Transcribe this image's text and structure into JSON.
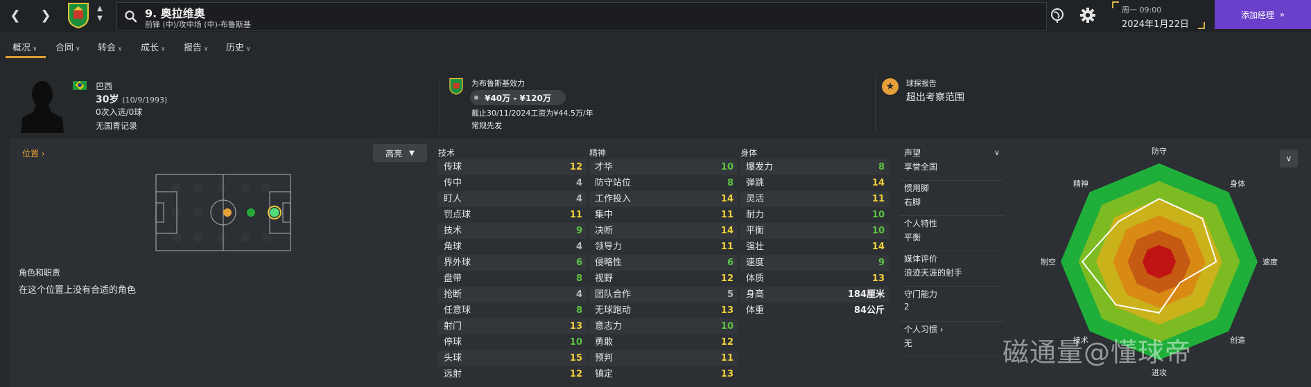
{
  "topbar": {
    "back_icon": "chevron-left-icon",
    "forward_icon": "chevron-right-icon",
    "player_title": "9. 奥拉维奥",
    "player_subtitle": "前锋 (中)/攻中场 (中)-布鲁斯基",
    "date_line1": "周一 09:00",
    "date_line2": "2024年1月22日",
    "add_manager_label": "添加经理",
    "add_manager_icon": "double-chevron-right-icon"
  },
  "tabs": [
    {
      "label": "概况"
    },
    {
      "label": "合同"
    },
    {
      "label": "转会"
    },
    {
      "label": "成长"
    },
    {
      "label": "报告"
    },
    {
      "label": "历史"
    }
  ],
  "profile": {
    "nationality": "巴西",
    "age": "30岁",
    "dob": "(10/9/1993)",
    "caps": "0次入选/0球",
    "youth": "无国青记录",
    "club_line": "为布鲁斯基效力",
    "value_range": "¥40万 - ¥120万",
    "contract": "截止30/11/2024工资为¥44.5万/年",
    "role_status": "常规先发",
    "scout_title": "球探报告",
    "scout_value": "超出考察范围"
  },
  "position_panel": {
    "title": "位置",
    "roles_title": "角色和职责",
    "roles_text": "在这个位置上没有合适的角色"
  },
  "highlight_label": "高亮",
  "attributes": {
    "technical": {
      "title": "技术",
      "rows": [
        {
          "name": "传球",
          "value": "12",
          "tone": "yellow"
        },
        {
          "name": "传中",
          "value": "4",
          "tone": "grey"
        },
        {
          "name": "盯人",
          "value": "4",
          "tone": "grey"
        },
        {
          "name": "罚点球",
          "value": "11",
          "tone": "yellow"
        },
        {
          "name": "技术",
          "value": "9",
          "tone": "green"
        },
        {
          "name": "角球",
          "value": "4",
          "tone": "grey"
        },
        {
          "name": "界外球",
          "value": "6",
          "tone": "green"
        },
        {
          "name": "盘带",
          "value": "8",
          "tone": "green"
        },
        {
          "name": "抢断",
          "value": "4",
          "tone": "grey"
        },
        {
          "name": "任意球",
          "value": "8",
          "tone": "green"
        },
        {
          "name": "射门",
          "value": "13",
          "tone": "yellow"
        },
        {
          "name": "停球",
          "value": "10",
          "tone": "green"
        },
        {
          "name": "头球",
          "value": "15",
          "tone": "yellow"
        },
        {
          "name": "远射",
          "value": "12",
          "tone": "yellow"
        }
      ]
    },
    "mental": {
      "title": "精神",
      "rows": [
        {
          "name": "才华",
          "value": "10",
          "tone": "green"
        },
        {
          "name": "防守站位",
          "value": "8",
          "tone": "green"
        },
        {
          "name": "工作投入",
          "value": "14",
          "tone": "yellow"
        },
        {
          "name": "集中",
          "value": "11",
          "tone": "yellow"
        },
        {
          "name": "决断",
          "value": "14",
          "tone": "yellow"
        },
        {
          "name": "领导力",
          "value": "11",
          "tone": "yellow"
        },
        {
          "name": "侵略性",
          "value": "6",
          "tone": "green"
        },
        {
          "name": "视野",
          "value": "12",
          "tone": "yellow"
        },
        {
          "name": "团队合作",
          "value": "5",
          "tone": "grey"
        },
        {
          "name": "无球跑动",
          "value": "13",
          "tone": "yellow"
        },
        {
          "name": "意志力",
          "value": "10",
          "tone": "green"
        },
        {
          "name": "勇敢",
          "value": "12",
          "tone": "yellow"
        },
        {
          "name": "预判",
          "value": "11",
          "tone": "yellow"
        },
        {
          "name": "镇定",
          "value": "13",
          "tone": "yellow"
        }
      ]
    },
    "physical": {
      "title": "身体",
      "rows": [
        {
          "name": "爆发力",
          "value": "8",
          "tone": "green"
        },
        {
          "name": "弹跳",
          "value": "14",
          "tone": "yellow"
        },
        {
          "name": "灵活",
          "value": "11",
          "tone": "yellow"
        },
        {
          "name": "耐力",
          "value": "10",
          "tone": "green"
        },
        {
          "name": "平衡",
          "value": "10",
          "tone": "green"
        },
        {
          "name": "强壮",
          "value": "14",
          "tone": "yellow"
        },
        {
          "name": "速度",
          "value": "9",
          "tone": "green"
        },
        {
          "name": "体质",
          "value": "13",
          "tone": "yellow"
        },
        {
          "name": "身高",
          "value": "184厘米",
          "tone": "white"
        },
        {
          "name": "体重",
          "value": "84公斤",
          "tone": "white"
        }
      ]
    }
  },
  "side_info": [
    {
      "label": "声望",
      "value": "享誉全国"
    },
    {
      "label": "惯用脚",
      "value": "右脚"
    },
    {
      "label": "个人特性",
      "value": "平衡"
    },
    {
      "label": "媒体评价",
      "value": "浪迹天涯的射手"
    },
    {
      "label": "守门能力",
      "value": "2"
    },
    {
      "label": "个人习惯",
      "value": "无"
    }
  ],
  "radar": {
    "axes": [
      "防守",
      "身体",
      "速度",
      "创造",
      "进攻",
      "技术",
      "制空",
      "精神"
    ],
    "zone_colors": [
      "#1fae3a",
      "#7dbb23",
      "#c9b21a",
      "#d98a14",
      "#c55a12",
      "#c01414"
    ]
  },
  "watermark": "磁通量@懂球帝"
}
